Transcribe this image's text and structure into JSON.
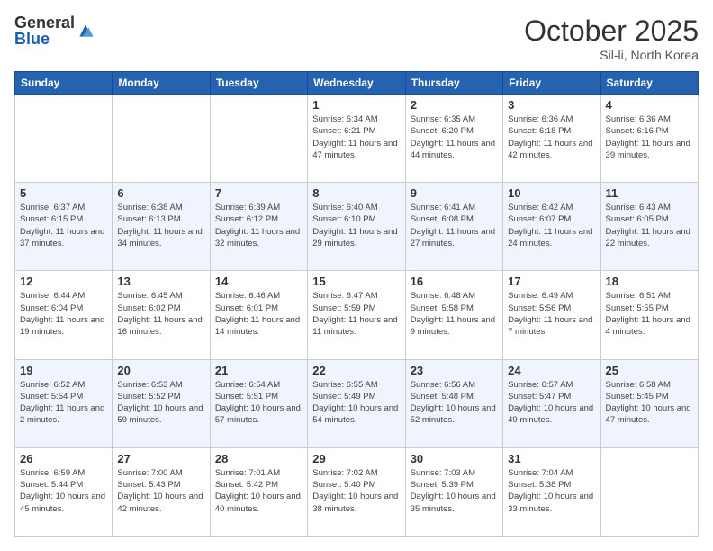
{
  "logo": {
    "general": "General",
    "blue": "Blue"
  },
  "header": {
    "month": "October 2025",
    "location": "Sil-li, North Korea"
  },
  "weekdays": [
    "Sunday",
    "Monday",
    "Tuesday",
    "Wednesday",
    "Thursday",
    "Friday",
    "Saturday"
  ],
  "weeks": [
    [
      {
        "day": "",
        "info": ""
      },
      {
        "day": "",
        "info": ""
      },
      {
        "day": "",
        "info": ""
      },
      {
        "day": "1",
        "info": "Sunrise: 6:34 AM\nSunset: 6:21 PM\nDaylight: 11 hours and 47 minutes."
      },
      {
        "day": "2",
        "info": "Sunrise: 6:35 AM\nSunset: 6:20 PM\nDaylight: 11 hours and 44 minutes."
      },
      {
        "day": "3",
        "info": "Sunrise: 6:36 AM\nSunset: 6:18 PM\nDaylight: 11 hours and 42 minutes."
      },
      {
        "day": "4",
        "info": "Sunrise: 6:36 AM\nSunset: 6:16 PM\nDaylight: 11 hours and 39 minutes."
      }
    ],
    [
      {
        "day": "5",
        "info": "Sunrise: 6:37 AM\nSunset: 6:15 PM\nDaylight: 11 hours and 37 minutes."
      },
      {
        "day": "6",
        "info": "Sunrise: 6:38 AM\nSunset: 6:13 PM\nDaylight: 11 hours and 34 minutes."
      },
      {
        "day": "7",
        "info": "Sunrise: 6:39 AM\nSunset: 6:12 PM\nDaylight: 11 hours and 32 minutes."
      },
      {
        "day": "8",
        "info": "Sunrise: 6:40 AM\nSunset: 6:10 PM\nDaylight: 11 hours and 29 minutes."
      },
      {
        "day": "9",
        "info": "Sunrise: 6:41 AM\nSunset: 6:08 PM\nDaylight: 11 hours and 27 minutes."
      },
      {
        "day": "10",
        "info": "Sunrise: 6:42 AM\nSunset: 6:07 PM\nDaylight: 11 hours and 24 minutes."
      },
      {
        "day": "11",
        "info": "Sunrise: 6:43 AM\nSunset: 6:05 PM\nDaylight: 11 hours and 22 minutes."
      }
    ],
    [
      {
        "day": "12",
        "info": "Sunrise: 6:44 AM\nSunset: 6:04 PM\nDaylight: 11 hours and 19 minutes."
      },
      {
        "day": "13",
        "info": "Sunrise: 6:45 AM\nSunset: 6:02 PM\nDaylight: 11 hours and 16 minutes."
      },
      {
        "day": "14",
        "info": "Sunrise: 6:46 AM\nSunset: 6:01 PM\nDaylight: 11 hours and 14 minutes."
      },
      {
        "day": "15",
        "info": "Sunrise: 6:47 AM\nSunset: 5:59 PM\nDaylight: 11 hours and 11 minutes."
      },
      {
        "day": "16",
        "info": "Sunrise: 6:48 AM\nSunset: 5:58 PM\nDaylight: 11 hours and 9 minutes."
      },
      {
        "day": "17",
        "info": "Sunrise: 6:49 AM\nSunset: 5:56 PM\nDaylight: 11 hours and 7 minutes."
      },
      {
        "day": "18",
        "info": "Sunrise: 6:51 AM\nSunset: 5:55 PM\nDaylight: 11 hours and 4 minutes."
      }
    ],
    [
      {
        "day": "19",
        "info": "Sunrise: 6:52 AM\nSunset: 5:54 PM\nDaylight: 11 hours and 2 minutes."
      },
      {
        "day": "20",
        "info": "Sunrise: 6:53 AM\nSunset: 5:52 PM\nDaylight: 10 hours and 59 minutes."
      },
      {
        "day": "21",
        "info": "Sunrise: 6:54 AM\nSunset: 5:51 PM\nDaylight: 10 hours and 57 minutes."
      },
      {
        "day": "22",
        "info": "Sunrise: 6:55 AM\nSunset: 5:49 PM\nDaylight: 10 hours and 54 minutes."
      },
      {
        "day": "23",
        "info": "Sunrise: 6:56 AM\nSunset: 5:48 PM\nDaylight: 10 hours and 52 minutes."
      },
      {
        "day": "24",
        "info": "Sunrise: 6:57 AM\nSunset: 5:47 PM\nDaylight: 10 hours and 49 minutes."
      },
      {
        "day": "25",
        "info": "Sunrise: 6:58 AM\nSunset: 5:45 PM\nDaylight: 10 hours and 47 minutes."
      }
    ],
    [
      {
        "day": "26",
        "info": "Sunrise: 6:59 AM\nSunset: 5:44 PM\nDaylight: 10 hours and 45 minutes."
      },
      {
        "day": "27",
        "info": "Sunrise: 7:00 AM\nSunset: 5:43 PM\nDaylight: 10 hours and 42 minutes."
      },
      {
        "day": "28",
        "info": "Sunrise: 7:01 AM\nSunset: 5:42 PM\nDaylight: 10 hours and 40 minutes."
      },
      {
        "day": "29",
        "info": "Sunrise: 7:02 AM\nSunset: 5:40 PM\nDaylight: 10 hours and 38 minutes."
      },
      {
        "day": "30",
        "info": "Sunrise: 7:03 AM\nSunset: 5:39 PM\nDaylight: 10 hours and 35 minutes."
      },
      {
        "day": "31",
        "info": "Sunrise: 7:04 AM\nSunset: 5:38 PM\nDaylight: 10 hours and 33 minutes."
      },
      {
        "day": "",
        "info": ""
      }
    ]
  ]
}
